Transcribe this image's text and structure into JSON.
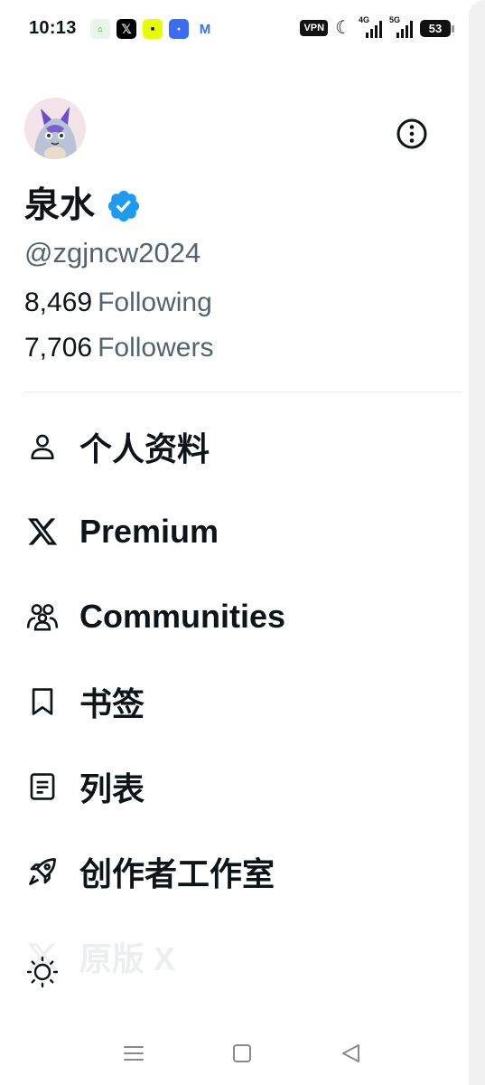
{
  "status_bar": {
    "time": "10:13",
    "notification_icons": [
      "home-app-icon",
      "x-app-icon",
      "yellow-app-icon",
      "blue-app-icon",
      "gmail-icon"
    ],
    "vpn": "VPN",
    "signal_1_label": "4G",
    "signal_2_label": "5G",
    "battery": "53"
  },
  "profile": {
    "display_name": "泉水",
    "handle": "@zgjncw2024",
    "following_count": "8,469",
    "following_label": "Following",
    "followers_count": "7,706",
    "followers_label": "Followers",
    "verified": true
  },
  "menu": {
    "items": [
      {
        "label": "个人资料",
        "icon": "person-icon"
      },
      {
        "label": "Premium",
        "icon": "x-logo-icon"
      },
      {
        "label": "Communities",
        "icon": "communities-icon"
      },
      {
        "label": "书签",
        "icon": "bookmark-icon"
      },
      {
        "label": "列表",
        "icon": "list-icon"
      },
      {
        "label": "创作者工作室",
        "icon": "rocket-icon"
      },
      {
        "label": "原版 X",
        "icon": "x-logo-icon"
      }
    ]
  },
  "colors": {
    "text_primary": "#0f1419",
    "text_secondary": "#536471",
    "verified_blue": "#1d9bf0",
    "divider": "#e7e9ea"
  }
}
